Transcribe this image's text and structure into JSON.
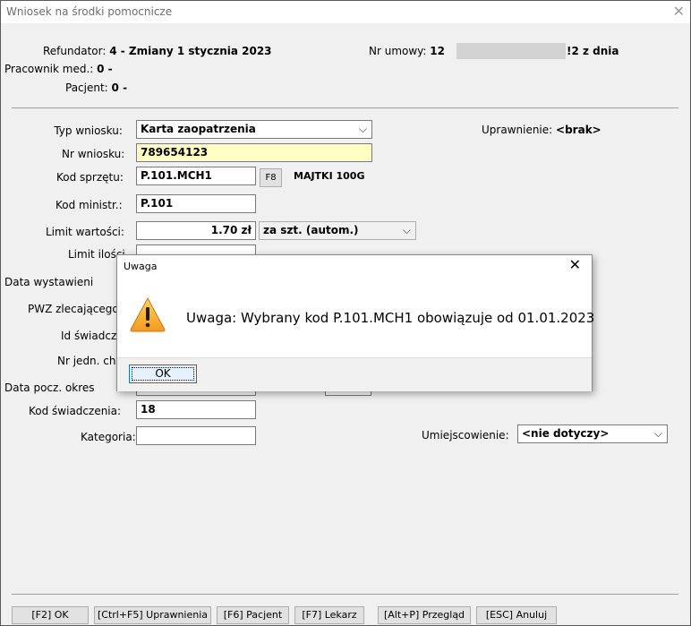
{
  "window": {
    "title": "Wniosek na środki pomocnicze",
    "close": "✕"
  },
  "header": {
    "refundator_label": "Refundator:",
    "refundator_value": "4 - Zmiany 1 stycznia 2023",
    "pracownik_label": "Pracownik med.:",
    "pracownik_value": "0 -",
    "pacjent_label": "Pacjent:",
    "pacjent_value": "0 -",
    "nr_umowy_label": "Nr umowy:",
    "nr_umowy_prefix": "12",
    "nr_umowy_suffix": "!2 z dnia"
  },
  "form": {
    "typ_wniosku_label": "Typ wniosku:",
    "typ_wniosku_value": "Karta zaopatrzenia",
    "uprawnienie_label": "Uprawnienie:",
    "uprawnienie_value": "<brak>",
    "nr_wniosku_label": "Nr wniosku:",
    "nr_wniosku_value": "789654123",
    "kod_sprzetu_label": "Kod sprzętu:",
    "kod_sprzetu_value": "P.101.MCH1",
    "f8_label": "F8",
    "sprzet_name": "MAJTKI 100G",
    "kod_ministr_label": "Kod ministr.:",
    "kod_ministr_value": "P.101",
    "limit_wartosci_label": "Limit wartości:",
    "limit_wartosci_value": "1.70 zł",
    "limit_mode_value": "za szt. (autom.)",
    "limit_ilosci_label": "Limit ilości",
    "data_wystawienia_label": "Data wystawieni",
    "pwz_label": "PWZ zlecającego",
    "id_swiadcz_label": "Id świadcz",
    "nr_jedn_label": "Nr jedn. chor",
    "data_pocz_label": "Data pocz. okres",
    "kod_swiadczenia_label": "Kod świadczenia:",
    "kod_swiadczenia_value": "18",
    "kategoria_label": "Kategoria:",
    "kategoria_value": "",
    "umiejscowienie_label": "Umiejscowienie:",
    "umiejscowienie_value": "<nie dotyczy>"
  },
  "dialog": {
    "title": "Uwaga",
    "close": "✕",
    "message": "Uwaga: Wybrany kod P.101.MCH1 obowiązuje od 01.01.2023",
    "ok_label": "OK",
    "icon": "warning-icon"
  },
  "footer_buttons": [
    {
      "label": "[F2] OK"
    },
    {
      "label": "[Ctrl+F5] Uprawnienia"
    },
    {
      "label": "[F6] Pacjent"
    },
    {
      "label": "[F7] Lekarz"
    },
    {
      "label": "[Alt+P] Przegląd"
    },
    {
      "label": "[ESC] Anuluj"
    }
  ],
  "colors": {
    "highlight_field": "#ffffc4",
    "warning": "#f5a623",
    "dialog_button_border": "#0078d7"
  }
}
